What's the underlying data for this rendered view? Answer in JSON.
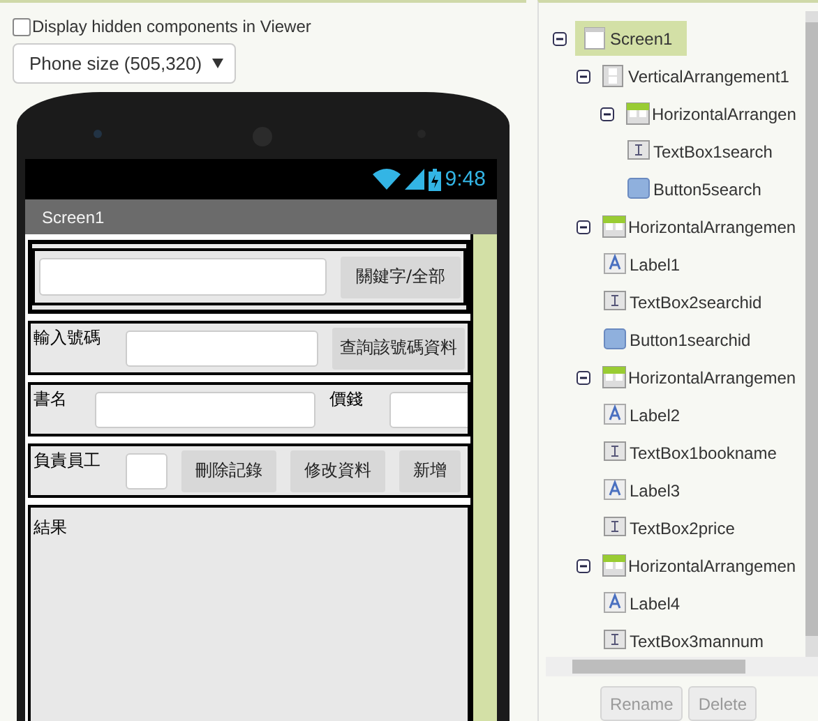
{
  "viewer": {
    "hidden_toggle": {
      "label": "Display hidden components in Viewer",
      "checked": false
    },
    "size_select": {
      "value": "Phone size (505,320)"
    },
    "phone": {
      "time": "9:48",
      "title": "Screen1",
      "rows": [
        {
          "items": [
            {
              "kind": "textbox"
            },
            {
              "kind": "button",
              "label": "關鍵字/全部"
            }
          ]
        },
        {
          "items": [
            {
              "kind": "label",
              "label": "輸入號碼"
            },
            {
              "kind": "textbox"
            },
            {
              "kind": "button",
              "label": "查詢該號碼資料"
            }
          ]
        },
        {
          "items": [
            {
              "kind": "label",
              "label": "書名"
            },
            {
              "kind": "textbox"
            },
            {
              "kind": "label",
              "label": "價錢"
            },
            {
              "kind": "textbox"
            }
          ]
        },
        {
          "items": [
            {
              "kind": "label",
              "label": "負責員工"
            },
            {
              "kind": "textbox"
            },
            {
              "kind": "button",
              "label": "刪除記錄"
            },
            {
              "kind": "button",
              "label": "修改資料"
            },
            {
              "kind": "button",
              "label": "新增"
            }
          ]
        }
      ],
      "result": {
        "label": "結果"
      }
    }
  },
  "tree": {
    "items": [
      {
        "kind": "screen",
        "label": "Screen1",
        "selected": true,
        "expanded": true,
        "children": [
          {
            "kind": "vertical",
            "label": "VerticalArrangement1",
            "selected": false,
            "expanded": true,
            "children": [
              {
                "kind": "horizontal",
                "label": "HorizontalArrangen",
                "selected": false,
                "expanded": true,
                "children": [
                  {
                    "kind": "textbox",
                    "label": "TextBox1search",
                    "selected": false
                  },
                  {
                    "kind": "button",
                    "label": "Button5search",
                    "selected": false
                  }
                ]
              }
            ]
          },
          {
            "kind": "horizontal",
            "label": "HorizontalArrangemen",
            "selected": false,
            "expanded": true,
            "children": [
              {
                "kind": "label",
                "label": "Label1",
                "selected": false
              },
              {
                "kind": "textbox",
                "label": "TextBox2searchid",
                "selected": false
              },
              {
                "kind": "button",
                "label": "Button1searchid",
                "selected": false
              }
            ]
          },
          {
            "kind": "horizontal",
            "label": "HorizontalArrangemen",
            "selected": false,
            "expanded": true,
            "children": [
              {
                "kind": "label",
                "label": "Label2",
                "selected": false
              },
              {
                "kind": "textbox",
                "label": "TextBox1bookname",
                "selected": false
              },
              {
                "kind": "label",
                "label": "Label3",
                "selected": false
              },
              {
                "kind": "textbox",
                "label": "TextBox2price",
                "selected": false
              }
            ]
          },
          {
            "kind": "horizontal",
            "label": "HorizontalArrangemen",
            "selected": false,
            "expanded": true,
            "children": [
              {
                "kind": "label",
                "label": "Label4",
                "selected": false
              },
              {
                "kind": "textbox",
                "label": "TextBox3mannum",
                "selected": false
              }
            ]
          }
        ]
      }
    ]
  },
  "buttons": [
    {
      "label": "Rename",
      "disabled": true
    },
    {
      "label": "Delete",
      "disabled": true
    }
  ]
}
